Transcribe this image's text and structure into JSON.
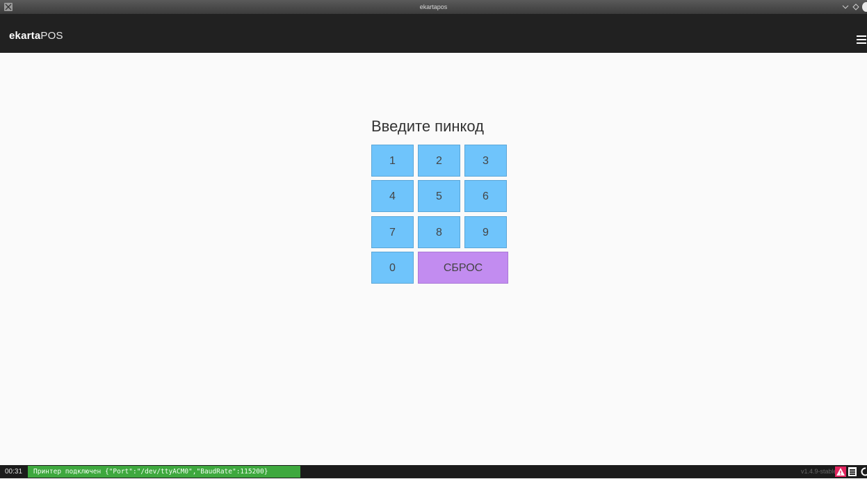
{
  "window": {
    "title": "ekartapos"
  },
  "header": {
    "brand_bold": "ekarta",
    "brand_light": "POS"
  },
  "pin": {
    "title": "Введите пинкод",
    "keys": [
      "1",
      "2",
      "3",
      "4",
      "5",
      "6",
      "7",
      "8",
      "9",
      "0"
    ],
    "reset_label": "СБРОС"
  },
  "status": {
    "time": "00:31",
    "printer_message": "Принтер подключен {\"Port\":\"/dev/ttyACM0\",\"BaudRate\":115200}",
    "version": "v1.4.9-stable"
  },
  "colors": {
    "header_bg": "#212121",
    "key_bg": "#6fc4fb",
    "reset_bg": "#c28cf0",
    "status_ok": "#3ea83e",
    "warning": "#e0245e"
  },
  "icons": [
    "app-icon",
    "minimize-icon",
    "maximize-icon",
    "close-icon",
    "menu-icon",
    "warning-icon",
    "log-icon",
    "sync-icon"
  ]
}
